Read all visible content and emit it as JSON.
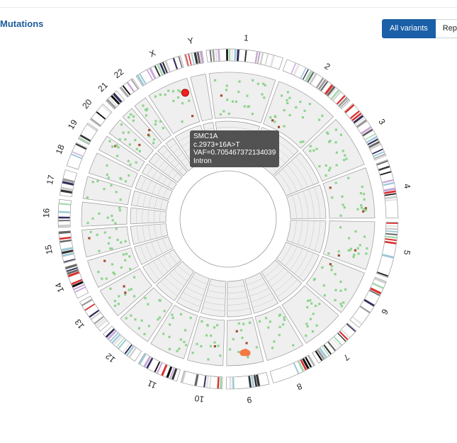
{
  "header": {
    "title": "Mutations"
  },
  "toggle": {
    "all_variants": "All variants",
    "reported": "Rep"
  },
  "tooltip": {
    "gene": "SMC1A",
    "change": "c.2973+16A>T",
    "vaf": "VAF=0.705467372134039",
    "consequence": "Intron"
  },
  "colors": {
    "accent": "#1a5fa8",
    "mutation_point": "#8fd48f",
    "highlighted_point": "#ee2222",
    "cluster_point": "#f47a45",
    "track_fill": "#efefef"
  },
  "chart_data": {
    "type": "circos",
    "chromosomes": [
      {
        "name": "1",
        "size": 249
      },
      {
        "name": "2",
        "size": 242
      },
      {
        "name": "3",
        "size": 198
      },
      {
        "name": "4",
        "size": 190
      },
      {
        "name": "5",
        "size": 181
      },
      {
        "name": "6",
        "size": 171
      },
      {
        "name": "7",
        "size": 159
      },
      {
        "name": "8",
        "size": 145
      },
      {
        "name": "9",
        "size": 138
      },
      {
        "name": "10",
        "size": 134
      },
      {
        "name": "11",
        "size": 135
      },
      {
        "name": "12",
        "size": 133
      },
      {
        "name": "13",
        "size": 114
      },
      {
        "name": "14",
        "size": 107
      },
      {
        "name": "15",
        "size": 102
      },
      {
        "name": "16",
        "size": 90
      },
      {
        "name": "17",
        "size": 83
      },
      {
        "name": "18",
        "size": 80
      },
      {
        "name": "19",
        "size": 59
      },
      {
        "name": "20",
        "size": 64
      },
      {
        "name": "21",
        "size": 47
      },
      {
        "name": "22",
        "size": 51
      },
      {
        "name": "X",
        "size": 156
      },
      {
        "name": "Y",
        "size": 57
      }
    ],
    "highlighted_variant": {
      "chromosome": "X",
      "position_fraction": 0.85,
      "vaf": 0.705467372134039
    },
    "cluster": {
      "chromosome": "9",
      "position_fraction": 0.4,
      "vaf": 0.0
    }
  }
}
